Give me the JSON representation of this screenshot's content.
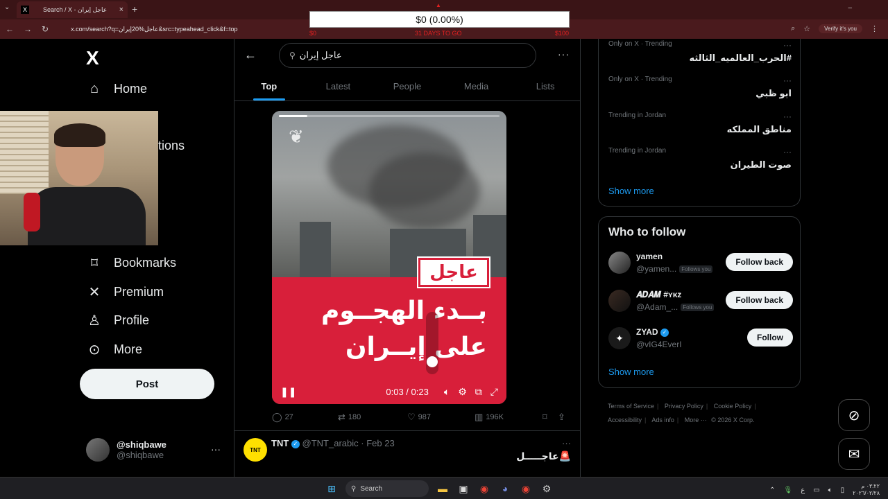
{
  "browser": {
    "tab_title": "Search / X - عاجل إيران",
    "url": "x.com/search?q=عاجل%20إيران&src=typeahead_click&f=top",
    "verify_label": "Verify it's you"
  },
  "donation": {
    "bar_text": "$0 (0.00%)",
    "left": "$0",
    "middle": "31 DAYS TO GO",
    "right": "$100"
  },
  "nav": {
    "logo": "X",
    "items": [
      {
        "label": "Home",
        "icon": "home-icon"
      },
      {
        "label": "Bookmarks",
        "icon": "bookmark-icon"
      },
      {
        "label": "Premium",
        "icon": "x-icon"
      },
      {
        "label": "Profile",
        "icon": "person-icon"
      },
      {
        "label": "More",
        "icon": "more-circle-icon"
      }
    ],
    "partial_label": "tions",
    "post_label": "Post",
    "account": {
      "name": "@shiqbawe",
      "handle": "@shiqbawe"
    }
  },
  "search": {
    "query": "عاجل إيران",
    "tabs": [
      "Top",
      "Latest",
      "People",
      "Media",
      "Lists"
    ],
    "active_tab": "Top"
  },
  "video": {
    "badge": "عاجل",
    "line1": "بــدء الهجــوم",
    "line2": "على إيــران",
    "time": "0:03 / 0:23",
    "progress": 0.13
  },
  "tweet_actions": {
    "replies": "27",
    "reposts": "180",
    "likes": "987",
    "views": "196K"
  },
  "tweet2": {
    "name": "TNT",
    "handle": "@TNT_arabic",
    "date": "· Feb 23",
    "avatar_text": "TNT",
    "text": "🚨عاجـــــل"
  },
  "trends": [
    {
      "context": "Only on X · Trending",
      "title": "#الحرب_العالميه_الثالثه"
    },
    {
      "context": "Only on X · Trending",
      "title": "ابو ظبي"
    },
    {
      "context": "Trending in Jordan",
      "title": "مناطق المملكه"
    },
    {
      "context": "Trending in Jordan",
      "title": "صوت الطيران"
    }
  ],
  "show_more": "Show more",
  "who_to_follow": {
    "title": "Who to follow",
    "users": [
      {
        "name": "yamen",
        "handle": "@yamen...",
        "follows_you": "Follows you",
        "button": "Follow back"
      },
      {
        "name": "𝑨𝑫𝑨𝑴 #ʏᴋᴢ",
        "handle": "@Adam_...",
        "follows_you": "Follows you",
        "button": "Follow back"
      },
      {
        "name": "ZYAD",
        "handle": "@vIG4EverI",
        "follows_you": "",
        "button": "Follow"
      }
    ],
    "show_more": "Show more"
  },
  "footer": {
    "links": [
      "Terms of Service",
      "Privacy Policy",
      "Cookie Policy",
      "Accessibility",
      "Ads info",
      "More ···"
    ],
    "copyright": "© 2026 X Corp."
  },
  "taskbar": {
    "search": "Search",
    "lang": "ع",
    "time": "٠٣:٢٢ م",
    "date": "٢٠٢٦/٠٢/٢٨"
  }
}
